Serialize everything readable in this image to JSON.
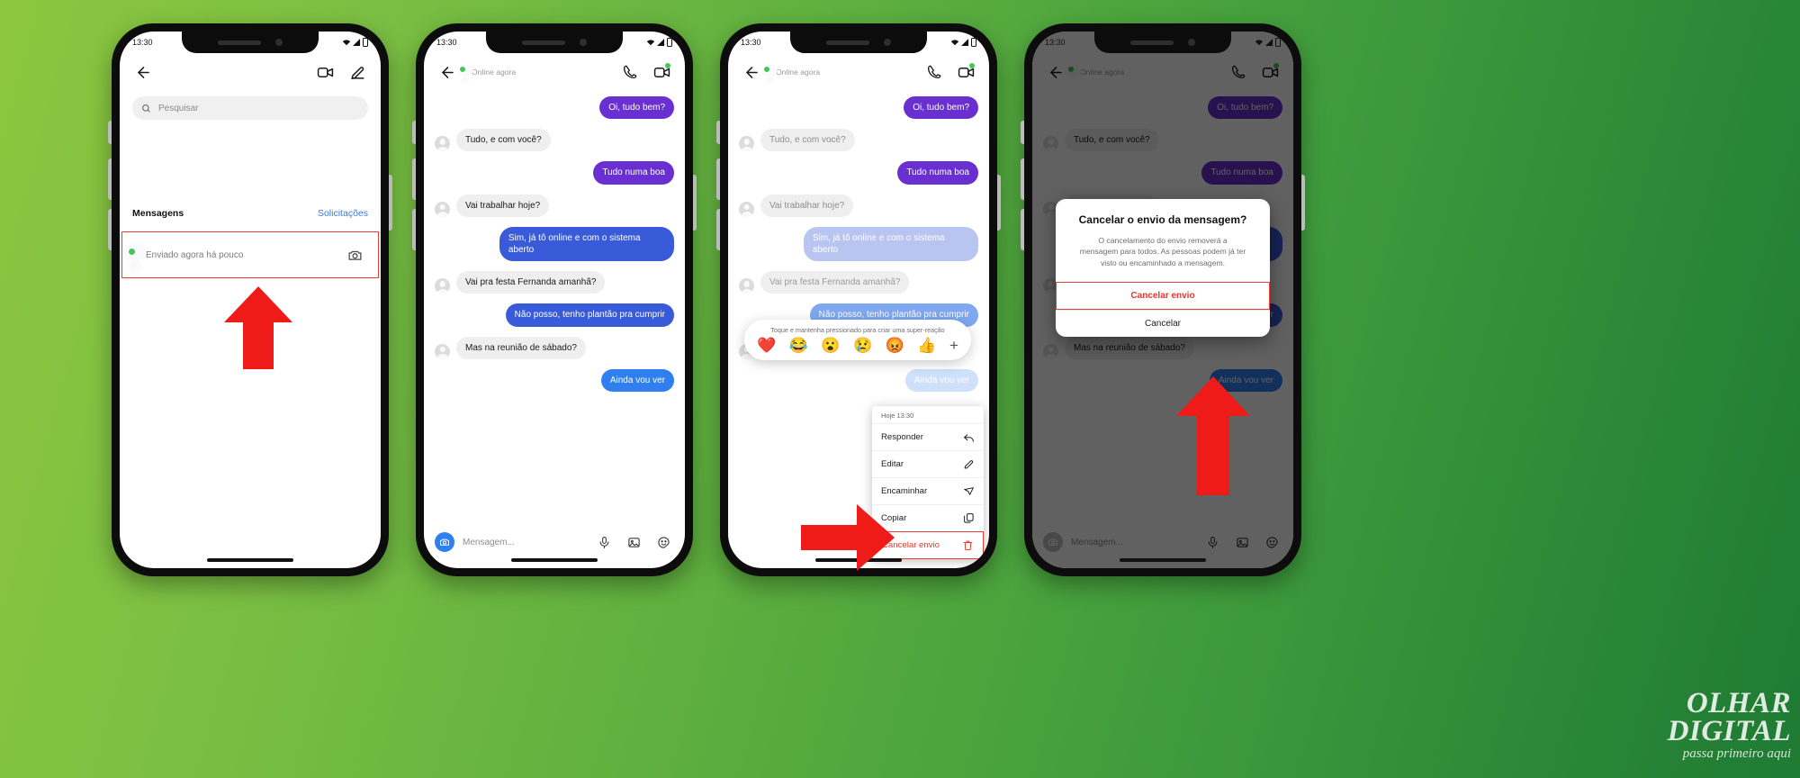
{
  "background": {
    "gradient_from": "#8cc63e",
    "gradient_to": "#1f7a34"
  },
  "status_bar": {
    "time": "13:30",
    "wifi_icon": "wifi-icon",
    "signal_icon": "signal-icon",
    "battery_icon": "battery-icon"
  },
  "colors": {
    "accent_blue": "#2f7ff0",
    "bubble_purple": "#6a2fd0",
    "bubble_blue": "#3a5bd9",
    "bubble_blue_light": "#2f7ff0",
    "bubble_them": "#efefef",
    "danger_red": "#e8362c",
    "highlight_border": "#ef3b33",
    "online_green": "#44c65a",
    "link_blue": "#3a7bd5"
  },
  "phone1": {
    "back_icon": "back-arrow-icon",
    "video_icon": "video-camera-icon",
    "compose_icon": "compose-pencil-icon",
    "search": {
      "icon": "search-icon",
      "placeholder": "Pesquisar",
      "value": ""
    },
    "section": {
      "title": "Mensagens",
      "action": "Solicitações"
    },
    "thread": {
      "avatar": "avatar",
      "online_badge": "online-dot",
      "preview": "Enviado agora há pouco",
      "camera_icon": "camera-icon"
    }
  },
  "phone2": {
    "header": {
      "back_icon": "back-arrow-icon",
      "status": "Online agora",
      "call_icon": "phone-call-icon",
      "video_icon": "video-camera-icon"
    },
    "messages": [
      {
        "from": "me",
        "text": "Oi, tudo bem?",
        "style": "purple"
      },
      {
        "from": "them",
        "text": "Tudo, e com você?"
      },
      {
        "from": "me",
        "text": "Tudo numa boa",
        "style": "purple"
      },
      {
        "from": "them",
        "text": "Vai trabalhar hoje?"
      },
      {
        "from": "me",
        "text": "Sim, já tô online e com o sistema aberto",
        "style": "blue"
      },
      {
        "from": "them",
        "text": "Vai pra festa Fernanda amanhã?"
      },
      {
        "from": "me",
        "text": "Não posso, tenho plantão pra cumprir",
        "style": "blue"
      },
      {
        "from": "them",
        "text": "Mas na reunião de sábado?"
      },
      {
        "from": "me",
        "text": "Ainda vou ver",
        "style": "blue-light"
      }
    ],
    "composer": {
      "camera_icon": "camera-icon",
      "placeholder": "Mensagem...",
      "mic_icon": "microphone-icon",
      "gallery_icon": "gallery-image-icon",
      "sticker_icon": "sticker-smiley-icon"
    }
  },
  "phone3": {
    "reaction_popup": {
      "hint": "Toque e mantenha pressionado para criar uma super-reação",
      "emojis": [
        "❤️",
        "😂",
        "😮",
        "😢",
        "😡",
        "👍"
      ],
      "plus": "+"
    },
    "context_menu": {
      "timestamp": "Hoje 13:30",
      "items": [
        {
          "label": "Responder",
          "icon": "reply-arrow-icon",
          "danger": false
        },
        {
          "label": "Editar",
          "icon": "pencil-icon",
          "danger": false
        },
        {
          "label": "Encaminhar",
          "icon": "forward-send-icon",
          "danger": false
        },
        {
          "label": "Copiar",
          "icon": "copy-icon",
          "danger": false
        },
        {
          "label": "Cancelar envio",
          "icon": "trash-bin-icon",
          "danger": true
        }
      ]
    }
  },
  "phone4": {
    "dialog": {
      "title": "Cancelar o envio da mensagem?",
      "body": "O cancelamento do envio removerá a mensagem para todos. As pessoas podem já ter visto ou encaminhado a mensagem.",
      "confirm_label": "Cancelar envio",
      "cancel_label": "Cancelar"
    }
  },
  "watermark": {
    "line1": "OLHAR",
    "line2": "DIGITAL",
    "tagline": "passa primeiro aqui"
  }
}
